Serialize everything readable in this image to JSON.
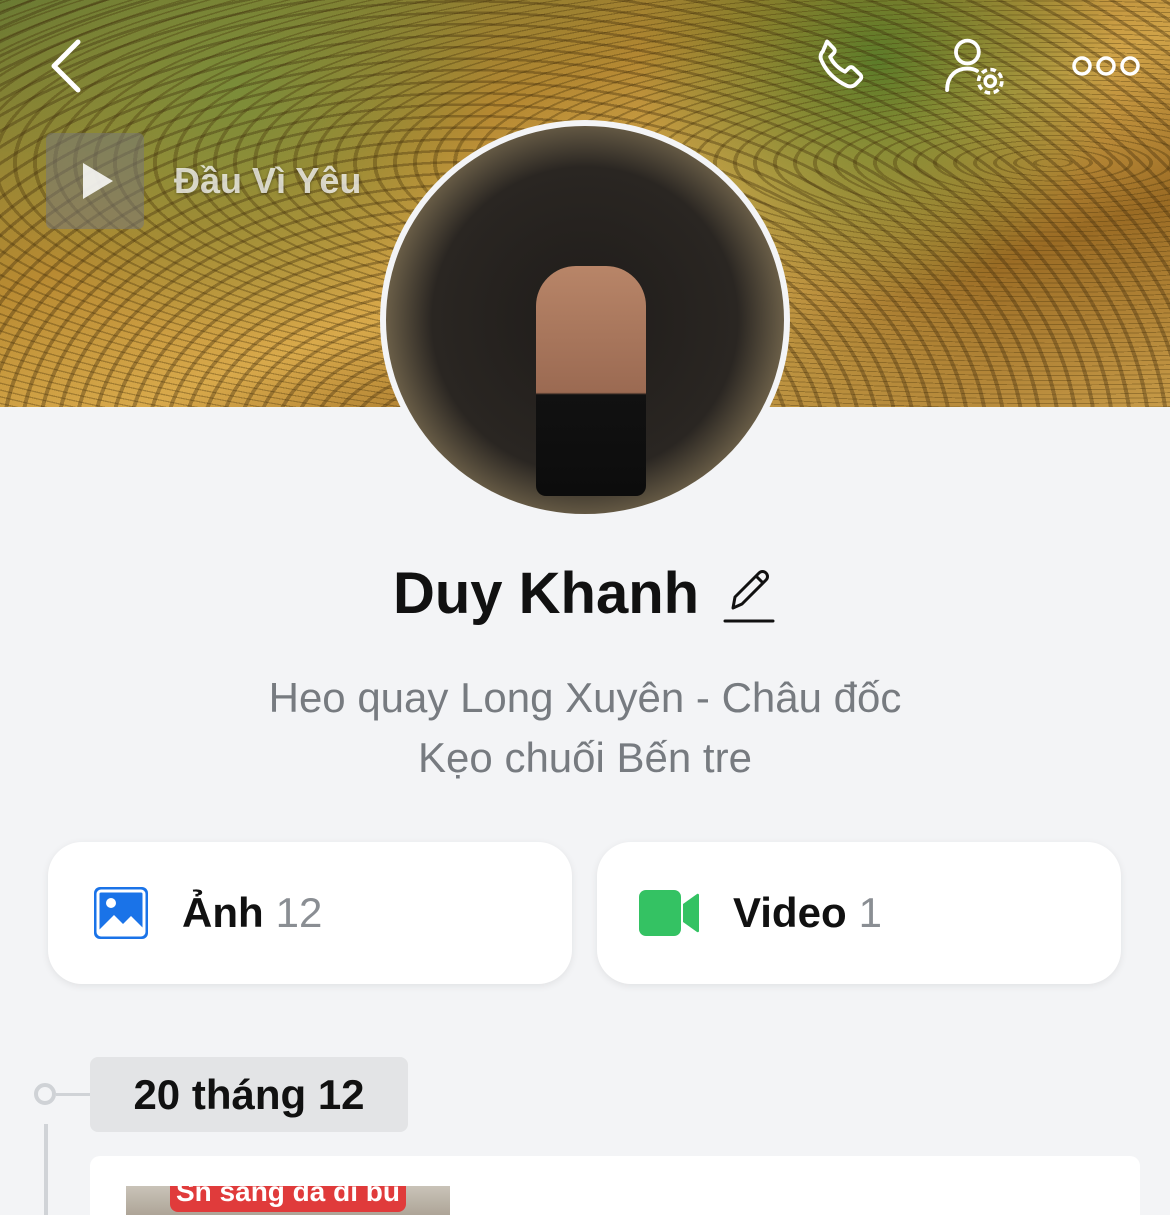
{
  "header": {
    "music": {
      "title": "Đầu   Vì Yêu"
    },
    "icons": {
      "back": "chevron-left-icon",
      "call": "phone-icon",
      "profile_settings": "user-gear-icon",
      "more": "more-dots-icon"
    }
  },
  "profile": {
    "name": "Duy Khanh",
    "bio_line_1": "Heo quay Long Xuyên - Châu đốc",
    "bio_line_2": "Kẹo chuối Bến tre"
  },
  "media": {
    "photos": {
      "label": "Ảnh",
      "count": "12",
      "icon": "image-icon",
      "color": "#1a73e8"
    },
    "videos": {
      "label": "Video",
      "count": "1",
      "icon": "video-camera-icon",
      "color": "#34c263"
    }
  },
  "timeline": {
    "date_label": "20 tháng 12",
    "post": {
      "caption": "Sn sáng đã đi bú"
    }
  }
}
